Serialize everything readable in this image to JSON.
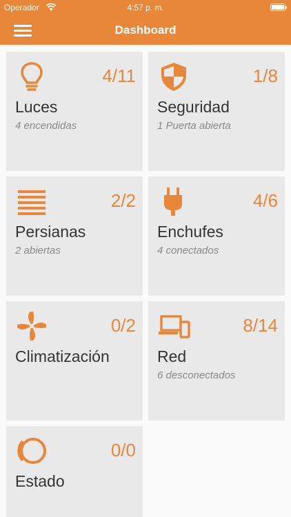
{
  "status": {
    "carrier": "Operador",
    "time": "4:57 p. m."
  },
  "header": {
    "title": "Dashboard"
  },
  "tiles": [
    {
      "name": "Luces",
      "count": "4/11",
      "subtitle": "4 encendidas",
      "icon": "lightbulb-icon"
    },
    {
      "name": "Seguridad",
      "count": "1/8",
      "subtitle": "1 Puerta abierta",
      "icon": "shield-icon"
    },
    {
      "name": "Persianas",
      "count": "2/2",
      "subtitle": "2 abiertas",
      "icon": "blinds-icon"
    },
    {
      "name": "Enchufes",
      "count": "4/6",
      "subtitle": "4 conectados",
      "icon": "plug-icon"
    },
    {
      "name": "Climatización",
      "count": "0/2",
      "subtitle": "",
      "icon": "fan-icon"
    },
    {
      "name": "Red",
      "count": "8/14",
      "subtitle": "6 desconectados",
      "icon": "devices-icon"
    },
    {
      "name": "Estado",
      "count": "0/0",
      "subtitle": "",
      "icon": "status-ring-icon"
    }
  ],
  "colors": {
    "accent": "#e8873a",
    "tile": "#e9e9e9"
  }
}
